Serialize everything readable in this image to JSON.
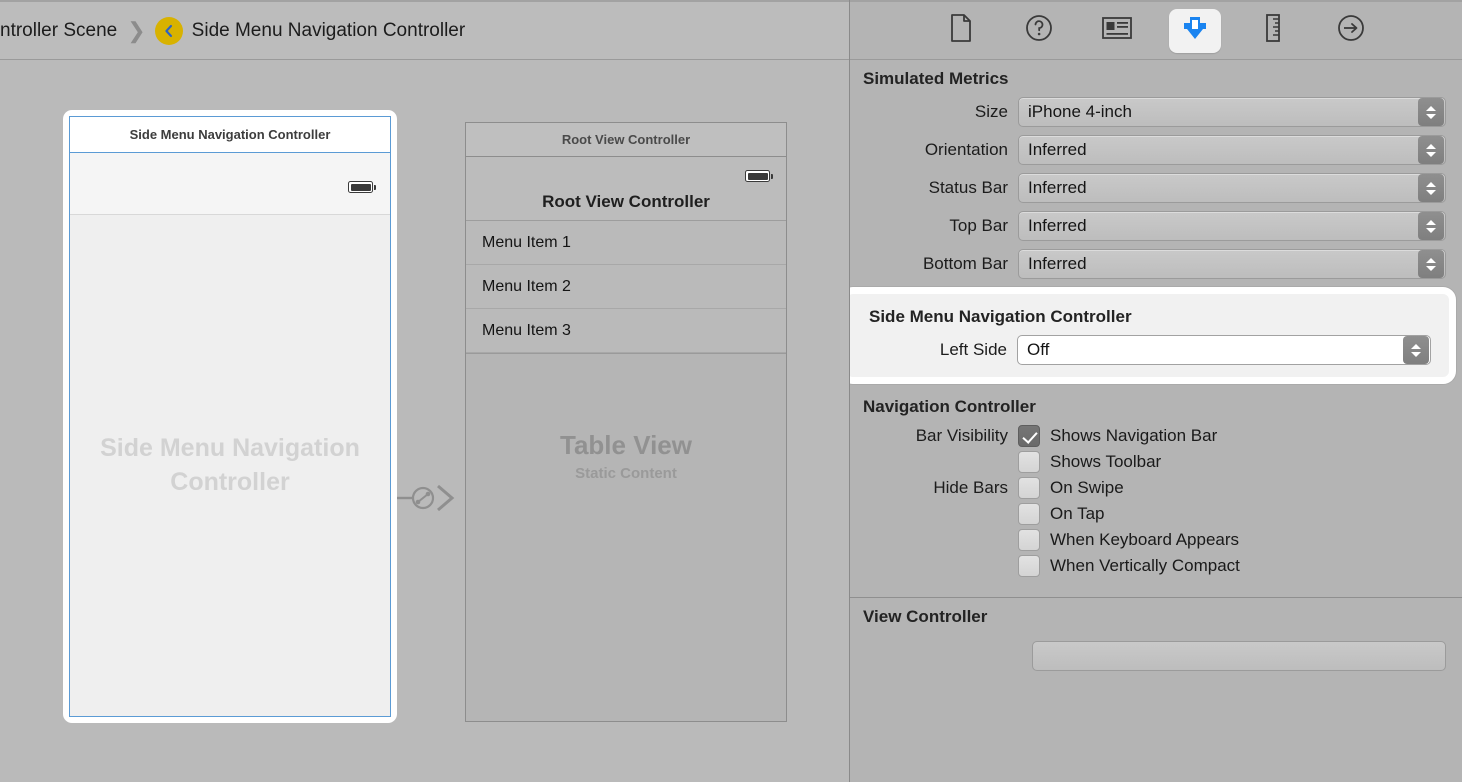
{
  "breadcrumb": {
    "truncated_crumb": "ntroller Scene",
    "separator": "❯",
    "current": "Side Menu Navigation Controller",
    "icon": "view-controller-badge-icon"
  },
  "canvas": {
    "left_scene": {
      "card_title": "Side Menu Navigation Controller",
      "placeholder": "Side Menu Navigation Controller",
      "status_icon": "battery-icon",
      "selection_color": "#5b9bd5"
    },
    "segue": {
      "icon": "relationship-segue-icon",
      "arrow": "arrow-right-icon"
    },
    "right_scene": {
      "card_title": "Root View Controller",
      "navbar_title": "Root View Controller",
      "status_icon": "battery-icon",
      "menu_items": [
        "Menu Item 1",
        "Menu Item 2",
        "Menu Item 3"
      ],
      "tableview_title": "Table View",
      "tableview_subtitle": "Static Content"
    }
  },
  "inspector": {
    "tabs": [
      {
        "name": "file-inspector",
        "icon": "document-icon",
        "selected": false
      },
      {
        "name": "quick-help-inspector",
        "icon": "question-circle-icon",
        "selected": false
      },
      {
        "name": "identity-inspector",
        "icon": "identity-card-icon",
        "selected": false
      },
      {
        "name": "attributes-inspector",
        "icon": "attributes-icon",
        "selected": true
      },
      {
        "name": "size-inspector",
        "icon": "ruler-icon",
        "selected": false
      },
      {
        "name": "connections-inspector",
        "icon": "arrow-circle-icon",
        "selected": false
      }
    ],
    "accent_color": "#1a84f0",
    "simulated_metrics": {
      "header": "Simulated Metrics",
      "rows": [
        {
          "label": "Size",
          "value": "iPhone 4-inch"
        },
        {
          "label": "Orientation",
          "value": "Inferred"
        },
        {
          "label": "Status Bar",
          "value": "Inferred"
        },
        {
          "label": "Top Bar",
          "value": "Inferred"
        },
        {
          "label": "Bottom Bar",
          "value": "Inferred"
        }
      ]
    },
    "side_menu_navigation_controller": {
      "header": "Side Menu Navigation Controller",
      "highlighted": true,
      "rows": [
        {
          "label": "Left Side",
          "value": "Off"
        }
      ]
    },
    "navigation_controller": {
      "header": "Navigation Controller",
      "bar_visibility_label": "Bar Visibility",
      "hide_bars_label": "Hide Bars",
      "checkboxes": [
        {
          "label": "Shows Navigation Bar",
          "checked": true,
          "group": "bar_visibility"
        },
        {
          "label": "Shows Toolbar",
          "checked": false,
          "group": "bar_visibility"
        },
        {
          "label": "On Swipe",
          "checked": false,
          "group": "hide_bars"
        },
        {
          "label": "On Tap",
          "checked": false,
          "group": "hide_bars"
        },
        {
          "label": "When Keyboard Appears",
          "checked": false,
          "group": "hide_bars"
        },
        {
          "label": "When Vertically Compact",
          "checked": false,
          "group": "hide_bars"
        }
      ]
    },
    "view_controller": {
      "header": "View Controller"
    }
  }
}
